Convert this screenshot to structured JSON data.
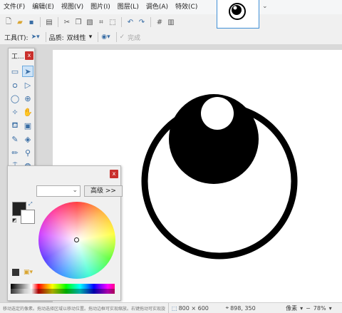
{
  "menu": {
    "file": "文件(F)",
    "edit": "编辑(E)",
    "view": "视图(V)",
    "image": "图片(I)",
    "layers": "图层(L)",
    "adjustments": "调色(A)",
    "effects": "特效(C)"
  },
  "toolbar": {
    "tool_label": "工具(T):",
    "quality_label": "品质:",
    "quality_value": "双线性",
    "done_label": "完成"
  },
  "tools_window": {
    "title": "工..."
  },
  "colors_window": {
    "advanced_label": "高级 >>",
    "primary_color": "#222222",
    "secondary_color": "#ffffff"
  },
  "canvas": {
    "background": "#ffffff"
  },
  "status": {
    "hint": "移动选定的像素。拖动选择区域以移动位置。拖动边框可实现缩放。右键拖动可实现旋转。",
    "image_size": "800 × 600",
    "cursor_pos": "898, 350",
    "unit": "像素",
    "zoom": "78%"
  }
}
